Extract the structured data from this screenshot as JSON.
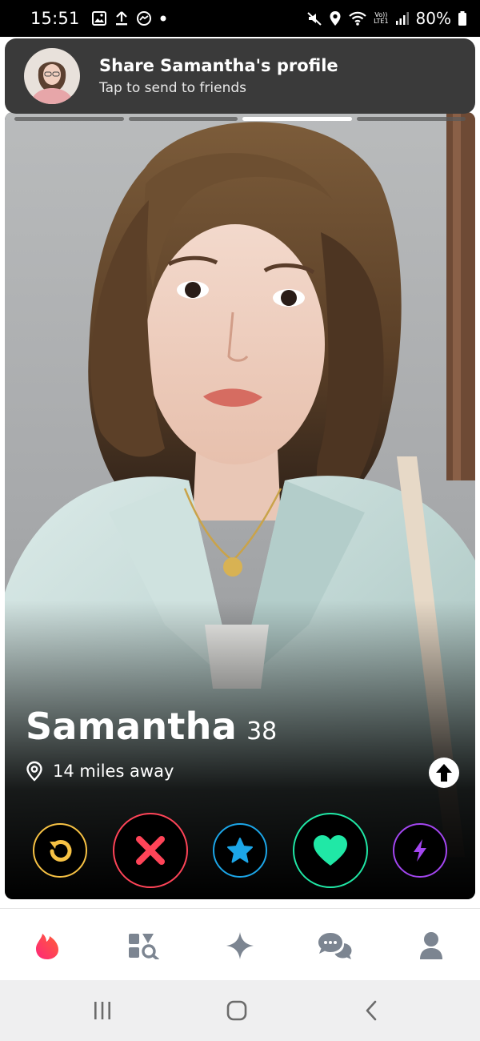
{
  "status_bar": {
    "time": "15:51",
    "battery_percent": "80%",
    "network_label_top": "Vo))",
    "network_label_bottom": "LTE1",
    "left_icons": [
      "image-icon",
      "upload-icon",
      "messenger-icon",
      "dot-icon"
    ],
    "right_icons": [
      "mute-icon",
      "location-icon",
      "wifi-icon",
      "signal-icon",
      "battery-icon"
    ]
  },
  "share_banner": {
    "title": "Share Samantha's profile",
    "subtitle": "Tap to send to friends"
  },
  "photo_progress": {
    "total": 4,
    "active_index": 2
  },
  "profile": {
    "name": "Samantha",
    "age": "38",
    "distance": "14 miles away"
  },
  "actions": [
    {
      "name": "rewind-button",
      "icon": "rewind-icon",
      "color": "#f7c244"
    },
    {
      "name": "nope-button",
      "icon": "x-icon",
      "color": "#ff4458"
    },
    {
      "name": "super-like-button",
      "icon": "star-icon",
      "color": "#1ca6e8"
    },
    {
      "name": "like-button",
      "icon": "heart-icon",
      "color": "#20e8a6"
    },
    {
      "name": "boost-button",
      "icon": "lightning-icon",
      "color": "#a346f0"
    }
  ],
  "bottom_nav": [
    {
      "name": "tab-discover",
      "icon": "flame-icon",
      "active": true,
      "color": "#fd3b6b"
    },
    {
      "name": "tab-explore",
      "icon": "explore-grid-icon",
      "active": false,
      "color": "#7c8591"
    },
    {
      "name": "tab-top-picks",
      "icon": "sparkle-icon",
      "active": false,
      "color": "#7c8591"
    },
    {
      "name": "tab-messages",
      "icon": "chat-icon",
      "active": false,
      "color": "#7c8591"
    },
    {
      "name": "tab-profile",
      "icon": "person-icon",
      "active": false,
      "color": "#7c8591"
    }
  ],
  "system_nav": [
    "recents-icon",
    "home-icon",
    "back-icon"
  ]
}
